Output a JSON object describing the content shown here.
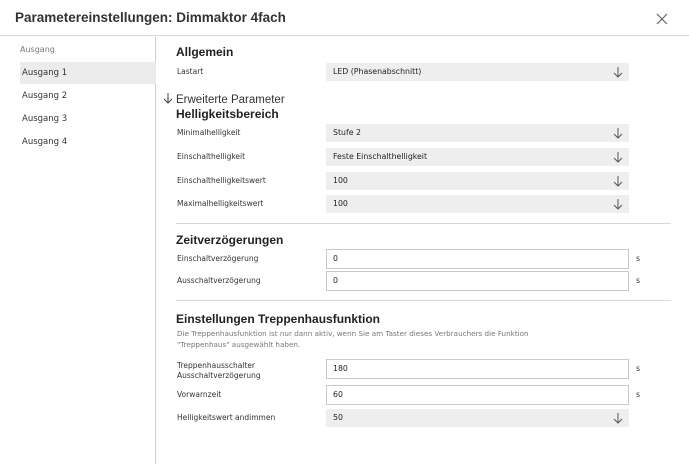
{
  "window": {
    "title": "Parametereinstellungen: Dimmaktor 4fach"
  },
  "sidebar": {
    "heading": "Ausgang",
    "items": [
      {
        "label": "Ausgang 1",
        "active": true
      },
      {
        "label": "Ausgang 2",
        "active": false
      },
      {
        "label": "Ausgang 3",
        "active": false
      },
      {
        "label": "Ausgang 4",
        "active": false
      }
    ]
  },
  "allgemein": {
    "title": "Allgemein",
    "lastart": {
      "label": "Lastart",
      "value": "LED (Phasenabschnitt)"
    }
  },
  "erweitert": {
    "label": "Erweiterte Parameter"
  },
  "helligkeit": {
    "title": "Helligkeitsbereich",
    "fields": [
      {
        "label": "Minimalhelligkeit",
        "value": "Stufe 2"
      },
      {
        "label": "Einschalthelligkeit",
        "value": "Feste Einschalthelligkeit"
      },
      {
        "label": "Einschalthelligkeitswert",
        "value": "100"
      },
      {
        "label": "Maximalhelligkeitswert",
        "value": "100"
      }
    ]
  },
  "zeit": {
    "title": "Zeitverzögerungen",
    "fields": [
      {
        "label": "Einschaltverzögerung",
        "value": "0",
        "unit": "s"
      },
      {
        "label": "Ausschaltverzögerung",
        "value": "0",
        "unit": "s"
      }
    ]
  },
  "treppe": {
    "title": "Einstellungen Treppenhausfunktion",
    "description_line1": "Die Treppenhausfunktion ist nur dann aktiv, wenn Sie am Taster dieses Verbrauchers die Funktion",
    "description_line2": "\"Treppenhaus\" ausgewählt haben.",
    "schalter": {
      "label_line1": "Treppenhausschalter",
      "label_line2": "Ausschaltverzögerung",
      "value": "180",
      "unit": "s"
    },
    "vorwarn": {
      "label": "Vorwarnzeit",
      "value": "60",
      "unit": "s"
    },
    "andimmen": {
      "label": "Helligkeitswert andimmen",
      "value": "50"
    }
  }
}
